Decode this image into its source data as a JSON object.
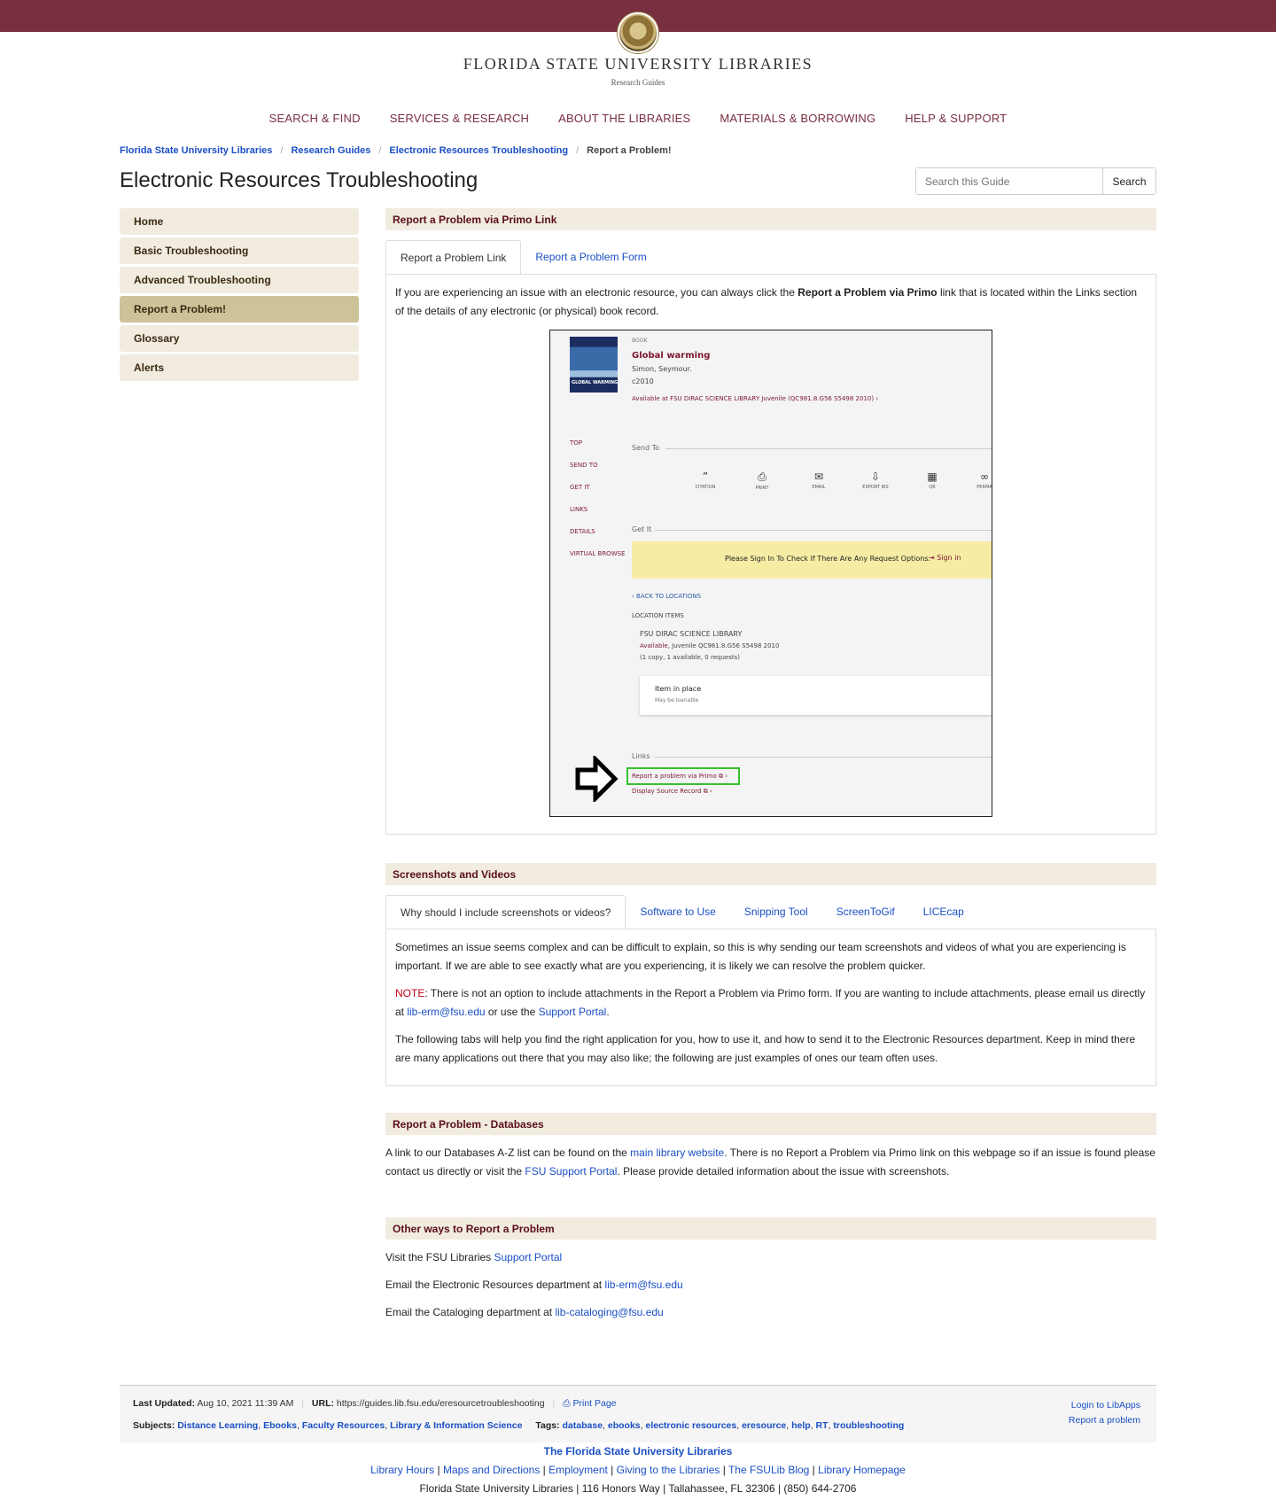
{
  "brand": {
    "name": "FLORIDA STATE UNIVERSITY LIBRARIES",
    "sub": "Research Guides"
  },
  "nav": [
    "SEARCH & FIND",
    "SERVICES & RESEARCH",
    "ABOUT THE LIBRARIES",
    "MATERIALS & BORROWING",
    "HELP & SUPPORT"
  ],
  "breadcrumb": [
    "Florida State University Libraries",
    "Research Guides",
    "Electronic Resources Troubleshooting",
    "Report a Problem!"
  ],
  "page_title": "Electronic Resources Troubleshooting",
  "search": {
    "placeholder": "Search this Guide",
    "button": "Search"
  },
  "sidebar": [
    "Home",
    "Basic Troubleshooting",
    "Advanced Troubleshooting",
    "Report a Problem!",
    "Glossary",
    "Alerts"
  ],
  "box1": {
    "title": "Report a Problem via Primo Link",
    "tabs": [
      "Report a Problem Link",
      "Report a Problem Form"
    ],
    "text_a": "If you are experiencing an issue with an electronic resource, you can always click the ",
    "text_b": "Report a Problem via Primo",
    "text_c": " link that is located within the Links section of the details of any electronic (or physical) book record."
  },
  "shot": {
    "cover_text": "GLOBAL WARMING",
    "type": "BOOK",
    "title": "Global warming",
    "author": "Simon, Seymour.",
    "date": "c2010",
    "availability": "Available at FSU DIRAC SCIENCE LIBRARY  Juvenile (QC981.8.G56 S5498 2010)  ›",
    "left_menu": [
      "TOP",
      "SEND TO",
      "GET IT",
      "LINKS",
      "DETAILS",
      "VIRTUAL BROWSE"
    ],
    "send_to": "Send To",
    "actions": [
      {
        "icon": "”",
        "label": "CITATION"
      },
      {
        "icon": "⎙",
        "label": "PRINT"
      },
      {
        "icon": "✉",
        "label": "EMAIL"
      },
      {
        "icon": "⇩",
        "label": "EXPORT RIS"
      },
      {
        "icon": "▦",
        "label": "QR"
      },
      {
        "icon": "∞",
        "label": "PERMA"
      }
    ],
    "get_it": "Get It",
    "signin_msg": "Please Sign In To Check If There Are Any Request Options.",
    "signin": "Sign in",
    "back": "‹  BACK TO LOCATIONS",
    "location_items": "LOCATION ITEMS",
    "library": "FSU DIRAC SCIENCE LIBRARY",
    "avail_word": "Available",
    "call_number": ", Juvenile QC981.8.G56 S5498 2010",
    "copies": "(1 copy, 1 available, 0 requests)",
    "item_status": "Item in place",
    "loan": "May be loanable",
    "links": "Links",
    "report_link": "Report a problem via Primo ⧉  ›",
    "display_link": "Display Source Record ⧉  ›"
  },
  "box2": {
    "title": "Screenshots and Videos",
    "tabs": [
      "Why should I include screenshots or videos?",
      "Software to Use",
      "Snipping Tool",
      "ScreenToGif",
      "LICEcap"
    ],
    "p1": "Sometimes an issue seems complex and can be difficult to explain, so this is why sending our team screenshots and videos of what you are experiencing is important. If we are able to see exactly what are you experiencing, it is likely we can resolve the problem quicker.",
    "note_label": "NOTE",
    "note_a": ": There is not an option to include attachments in the Report a Problem via Primo form. If you are wanting to include attachments, please email us directly at ",
    "note_email": "lib-erm@fsu.edu",
    "note_b": " or use the ",
    "note_portal": "Support Portal",
    "note_c": ".",
    "p3": "The following tabs will help you find the right application for you, how to use it, and how to send it to the Electronic Resources department. Keep in mind there are many applications out there that you may also like; the following are just examples of ones our team often uses."
  },
  "box3": {
    "title": "Report a Problem - Databases",
    "a": "A link to our Databases A-Z list can be found on the ",
    "link1": "main library website",
    "b": ". There is no Report a Problem via Primo link on this webpage so if an issue is found please contact us directly or visit the ",
    "link2": "FSU Support Portal",
    "c": ". Please provide detailed information about the issue with screenshots."
  },
  "box4": {
    "title": "Other ways to Report a Problem",
    "l1": "Visit the FSU Libraries ",
    "l1_link": "Support Portal",
    "l2": "Email the Electronic Resources department at ",
    "l2_link": "lib-erm@fsu.edu",
    "l3": "Email the Cataloging department at ",
    "l3_link": "lib-cataloging@fsu.edu"
  },
  "footer": {
    "updated_label": "Last Updated:",
    "updated": "Aug 10, 2021 11:39 AM",
    "url_label": "URL:",
    "url": "https://guides.lib.fsu.edu/eresourcetroubleshooting",
    "print": "Print Page",
    "subjects_label": "Subjects:",
    "subjects": [
      "Distance Learning",
      "Ebooks",
      "Faculty Resources",
      "Library & Information Science"
    ],
    "tags_label": "Tags:",
    "tags": [
      "database",
      "ebooks",
      "electronic resources",
      "eresource",
      "help",
      "RT",
      "troubleshooting"
    ],
    "login": "Login to LibApps",
    "report": "Report a problem",
    "org": "The Florida State University Libraries",
    "links": [
      "Library Hours",
      "Maps and Directions",
      "Employment",
      "Giving to the Libraries",
      "The FSULib Blog",
      "Library Homepage"
    ],
    "address": "Florida State University Libraries | 116 Honors Way | Tallahassee, FL 32306 | (850) 644-2706"
  },
  "colors": {
    "garnet": "#782f40",
    "gold": "#cec398",
    "panel": "#f1ebe0",
    "link": "#1a4fc4"
  }
}
